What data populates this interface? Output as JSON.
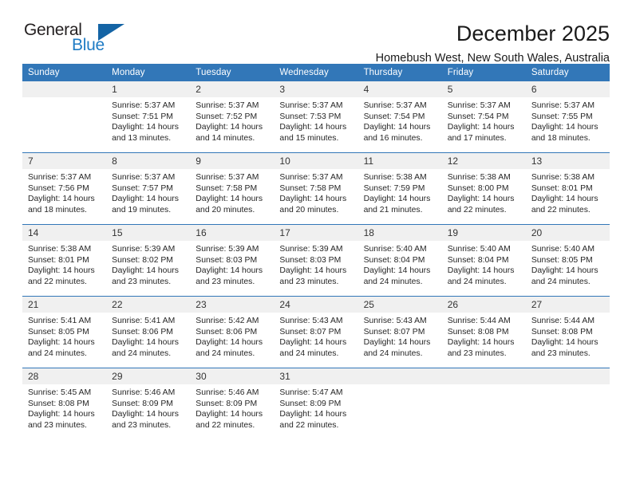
{
  "brand": {
    "name_part1": "General",
    "name_part2": "Blue",
    "triangle_icon": "triangle-icon",
    "color_dark": "#231f20",
    "color_blue": "#1e7bc4"
  },
  "header": {
    "title": "December 2025",
    "subtitle": "Homebush West, New South Wales, Australia"
  },
  "theme": {
    "header_bg": "#3277b8",
    "daynum_bg": "#f0f0f0",
    "row_divider": "#3277b8"
  },
  "weekday_headers": [
    "Sunday",
    "Monday",
    "Tuesday",
    "Wednesday",
    "Thursday",
    "Friday",
    "Saturday"
  ],
  "labels": {
    "sunrise": "Sunrise:",
    "sunset": "Sunset:",
    "daylight": "Daylight:"
  },
  "weeks": [
    [
      {
        "day": "",
        "empty": true
      },
      {
        "day": "1",
        "sunrise": "Sunrise: 5:37 AM",
        "sunset": "Sunset: 7:51 PM",
        "daylight_line1": "Daylight: 14 hours",
        "daylight_line2": "and 13 minutes."
      },
      {
        "day": "2",
        "sunrise": "Sunrise: 5:37 AM",
        "sunset": "Sunset: 7:52 PM",
        "daylight_line1": "Daylight: 14 hours",
        "daylight_line2": "and 14 minutes."
      },
      {
        "day": "3",
        "sunrise": "Sunrise: 5:37 AM",
        "sunset": "Sunset: 7:53 PM",
        "daylight_line1": "Daylight: 14 hours",
        "daylight_line2": "and 15 minutes."
      },
      {
        "day": "4",
        "sunrise": "Sunrise: 5:37 AM",
        "sunset": "Sunset: 7:54 PM",
        "daylight_line1": "Daylight: 14 hours",
        "daylight_line2": "and 16 minutes."
      },
      {
        "day": "5",
        "sunrise": "Sunrise: 5:37 AM",
        "sunset": "Sunset: 7:54 PM",
        "daylight_line1": "Daylight: 14 hours",
        "daylight_line2": "and 17 minutes."
      },
      {
        "day": "6",
        "sunrise": "Sunrise: 5:37 AM",
        "sunset": "Sunset: 7:55 PM",
        "daylight_line1": "Daylight: 14 hours",
        "daylight_line2": "and 18 minutes."
      }
    ],
    [
      {
        "day": "7",
        "sunrise": "Sunrise: 5:37 AM",
        "sunset": "Sunset: 7:56 PM",
        "daylight_line1": "Daylight: 14 hours",
        "daylight_line2": "and 18 minutes."
      },
      {
        "day": "8",
        "sunrise": "Sunrise: 5:37 AM",
        "sunset": "Sunset: 7:57 PM",
        "daylight_line1": "Daylight: 14 hours",
        "daylight_line2": "and 19 minutes."
      },
      {
        "day": "9",
        "sunrise": "Sunrise: 5:37 AM",
        "sunset": "Sunset: 7:58 PM",
        "daylight_line1": "Daylight: 14 hours",
        "daylight_line2": "and 20 minutes."
      },
      {
        "day": "10",
        "sunrise": "Sunrise: 5:37 AM",
        "sunset": "Sunset: 7:58 PM",
        "daylight_line1": "Daylight: 14 hours",
        "daylight_line2": "and 20 minutes."
      },
      {
        "day": "11",
        "sunrise": "Sunrise: 5:38 AM",
        "sunset": "Sunset: 7:59 PM",
        "daylight_line1": "Daylight: 14 hours",
        "daylight_line2": "and 21 minutes."
      },
      {
        "day": "12",
        "sunrise": "Sunrise: 5:38 AM",
        "sunset": "Sunset: 8:00 PM",
        "daylight_line1": "Daylight: 14 hours",
        "daylight_line2": "and 22 minutes."
      },
      {
        "day": "13",
        "sunrise": "Sunrise: 5:38 AM",
        "sunset": "Sunset: 8:01 PM",
        "daylight_line1": "Daylight: 14 hours",
        "daylight_line2": "and 22 minutes."
      }
    ],
    [
      {
        "day": "14",
        "sunrise": "Sunrise: 5:38 AM",
        "sunset": "Sunset: 8:01 PM",
        "daylight_line1": "Daylight: 14 hours",
        "daylight_line2": "and 22 minutes."
      },
      {
        "day": "15",
        "sunrise": "Sunrise: 5:39 AM",
        "sunset": "Sunset: 8:02 PM",
        "daylight_line1": "Daylight: 14 hours",
        "daylight_line2": "and 23 minutes."
      },
      {
        "day": "16",
        "sunrise": "Sunrise: 5:39 AM",
        "sunset": "Sunset: 8:03 PM",
        "daylight_line1": "Daylight: 14 hours",
        "daylight_line2": "and 23 minutes."
      },
      {
        "day": "17",
        "sunrise": "Sunrise: 5:39 AM",
        "sunset": "Sunset: 8:03 PM",
        "daylight_line1": "Daylight: 14 hours",
        "daylight_line2": "and 23 minutes."
      },
      {
        "day": "18",
        "sunrise": "Sunrise: 5:40 AM",
        "sunset": "Sunset: 8:04 PM",
        "daylight_line1": "Daylight: 14 hours",
        "daylight_line2": "and 24 minutes."
      },
      {
        "day": "19",
        "sunrise": "Sunrise: 5:40 AM",
        "sunset": "Sunset: 8:04 PM",
        "daylight_line1": "Daylight: 14 hours",
        "daylight_line2": "and 24 minutes."
      },
      {
        "day": "20",
        "sunrise": "Sunrise: 5:40 AM",
        "sunset": "Sunset: 8:05 PM",
        "daylight_line1": "Daylight: 14 hours",
        "daylight_line2": "and 24 minutes."
      }
    ],
    [
      {
        "day": "21",
        "sunrise": "Sunrise: 5:41 AM",
        "sunset": "Sunset: 8:05 PM",
        "daylight_line1": "Daylight: 14 hours",
        "daylight_line2": "and 24 minutes."
      },
      {
        "day": "22",
        "sunrise": "Sunrise: 5:41 AM",
        "sunset": "Sunset: 8:06 PM",
        "daylight_line1": "Daylight: 14 hours",
        "daylight_line2": "and 24 minutes."
      },
      {
        "day": "23",
        "sunrise": "Sunrise: 5:42 AM",
        "sunset": "Sunset: 8:06 PM",
        "daylight_line1": "Daylight: 14 hours",
        "daylight_line2": "and 24 minutes."
      },
      {
        "day": "24",
        "sunrise": "Sunrise: 5:43 AM",
        "sunset": "Sunset: 8:07 PM",
        "daylight_line1": "Daylight: 14 hours",
        "daylight_line2": "and 24 minutes."
      },
      {
        "day": "25",
        "sunrise": "Sunrise: 5:43 AM",
        "sunset": "Sunset: 8:07 PM",
        "daylight_line1": "Daylight: 14 hours",
        "daylight_line2": "and 24 minutes."
      },
      {
        "day": "26",
        "sunrise": "Sunrise: 5:44 AM",
        "sunset": "Sunset: 8:08 PM",
        "daylight_line1": "Daylight: 14 hours",
        "daylight_line2": "and 23 minutes."
      },
      {
        "day": "27",
        "sunrise": "Sunrise: 5:44 AM",
        "sunset": "Sunset: 8:08 PM",
        "daylight_line1": "Daylight: 14 hours",
        "daylight_line2": "and 23 minutes."
      }
    ],
    [
      {
        "day": "28",
        "sunrise": "Sunrise: 5:45 AM",
        "sunset": "Sunset: 8:08 PM",
        "daylight_line1": "Daylight: 14 hours",
        "daylight_line2": "and 23 minutes."
      },
      {
        "day": "29",
        "sunrise": "Sunrise: 5:46 AM",
        "sunset": "Sunset: 8:09 PM",
        "daylight_line1": "Daylight: 14 hours",
        "daylight_line2": "and 23 minutes."
      },
      {
        "day": "30",
        "sunrise": "Sunrise: 5:46 AM",
        "sunset": "Sunset: 8:09 PM",
        "daylight_line1": "Daylight: 14 hours",
        "daylight_line2": "and 22 minutes."
      },
      {
        "day": "31",
        "sunrise": "Sunrise: 5:47 AM",
        "sunset": "Sunset: 8:09 PM",
        "daylight_line1": "Daylight: 14 hours",
        "daylight_line2": "and 22 minutes."
      },
      {
        "day": "",
        "empty": true
      },
      {
        "day": "",
        "empty": true
      },
      {
        "day": "",
        "empty": true
      }
    ]
  ]
}
